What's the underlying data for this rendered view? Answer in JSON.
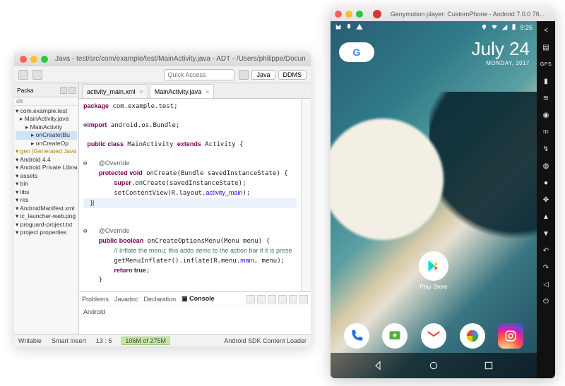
{
  "ide": {
    "title": "Java - test/src/com/example/test/MainActivity.java - ADT -  /Users/philippe/Documents/workspace",
    "quick_access_placeholder": "Quick Access",
    "perspectives": {
      "java": "Java",
      "ddms": "DDMS"
    },
    "explorer": {
      "tab_label": "Packa",
      "sfx": "sfc",
      "items": [
        {
          "label": "com.example.test",
          "lv": 0
        },
        {
          "label": "MainActivity.java",
          "lv": 1
        },
        {
          "label": "MainActivity",
          "lv": 2
        },
        {
          "label": "onCreate(Bu",
          "lv": 3,
          "sel": true
        },
        {
          "label": "onCreateOp",
          "lv": 3
        },
        {
          "label": "gen [Generated Java File",
          "lv": 0,
          "gen": true
        },
        {
          "label": "Android 4.4",
          "lv": 0
        },
        {
          "label": "Android Private Libraries",
          "lv": 0
        },
        {
          "label": "assets",
          "lv": 0
        },
        {
          "label": "bin",
          "lv": 0
        },
        {
          "label": "libs",
          "lv": 0
        },
        {
          "label": "res",
          "lv": 0
        },
        {
          "label": "AndroidManifest.xml",
          "lv": 0
        },
        {
          "label": "ic_launcher-web.png",
          "lv": 0
        },
        {
          "label": "proguard-project.txt",
          "lv": 0
        },
        {
          "label": "project.properties",
          "lv": 0
        }
      ]
    },
    "tabs": [
      {
        "label": "activity_main.xml",
        "active": false
      },
      {
        "label": "MainActivity.java",
        "active": true
      }
    ],
    "code": {
      "package": "package com.example.test;",
      "import": "import android.os.Bundle;",
      "cls": "public class MainActivity extends Activity {",
      "ov": "@Override",
      "m1": "    protected void onCreate(Bundle savedInstanceState) {",
      "m1a": "        super.onCreate(savedInstanceState);",
      "m1b": "        setContentView(R.layout.activity_main);",
      "m1c": "    }|",
      "m2": "    public boolean onCreateOptionsMenu(Menu menu) {",
      "m2a": "        // Inflate the menu; this adds items to the action bar if it is prese",
      "m2b": "        getMenuInflater().inflate(R.menu.main, menu);",
      "m2c": "        return true;",
      "m2d": "    }",
      "close": "}"
    },
    "bottom_tabs": [
      "Problems",
      "Javadoc",
      "Declaration",
      "Console"
    ],
    "bottom_active": 3,
    "bottom_body": "Android",
    "status": {
      "writable": "Writable",
      "smartinsert": "Smart Insert",
      "linecol": "13 : 6",
      "mem": "106M of 275M",
      "loader": "Android SDK Content Loader"
    }
  },
  "emu": {
    "title": "Genymotion player: CustomPhone - Android 7.0.0 76...",
    "statusbar": {
      "time": "9:26"
    },
    "date": {
      "big": "July 24",
      "small": "MONDAY, 2017"
    },
    "playstore_label": "Play Store",
    "dock": [
      "Phone",
      "Messages",
      "Gmail",
      "Photos",
      "Instagram"
    ],
    "nav": [
      "Back",
      "Home",
      "Recents"
    ],
    "sidebar_primary": [
      "share",
      "open",
      "gps",
      "battery",
      "wifi",
      "camera",
      "id",
      "network",
      "disk",
      "mic",
      "dpad",
      "volume-up",
      "volume-down",
      "rotate-left",
      "rotate-right",
      "back",
      "power"
    ]
  }
}
